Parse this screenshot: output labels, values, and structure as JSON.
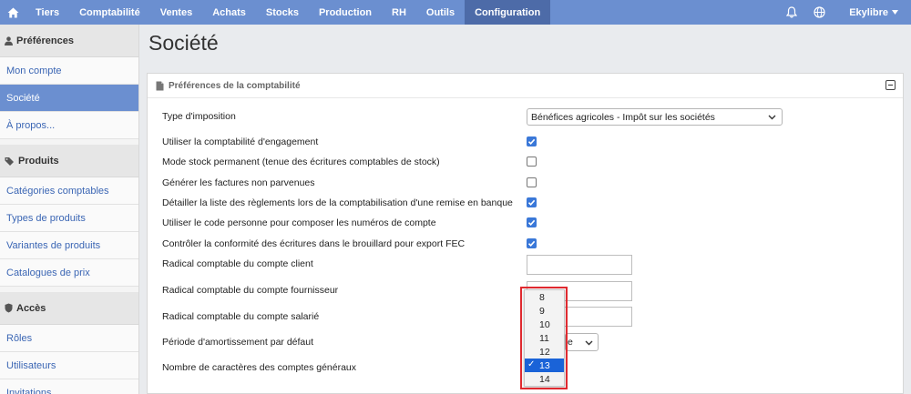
{
  "nav": {
    "items": [
      "Tiers",
      "Comptabilité",
      "Ventes",
      "Achats",
      "Stocks",
      "Production",
      "RH",
      "Outils",
      "Configuration"
    ],
    "active": "Configuration",
    "user": "Ekylibre"
  },
  "sidebar": {
    "sections": [
      {
        "title": "Préférences",
        "items": [
          "Mon compte",
          "Société",
          "À propos..."
        ]
      },
      {
        "title": "Produits",
        "items": [
          "Catégories comptables",
          "Types de produits",
          "Variantes de produits",
          "Catalogues de prix"
        ]
      },
      {
        "title": "Accès",
        "items": [
          "Rôles",
          "Utilisateurs",
          "Invitations"
        ]
      }
    ],
    "active_item": "Société"
  },
  "page": {
    "title": "Société",
    "panel_title": "Préférences de la comptabilité"
  },
  "form": {
    "tax_regime": {
      "label": "Type d'imposition",
      "value": "Bénéfices agricoles - Impôt sur les sociétés"
    },
    "checkboxes": [
      {
        "label": "Utiliser la comptabilité d'engagement",
        "checked": true
      },
      {
        "label": "Mode stock permanent (tenue des écritures comptables de stock)",
        "checked": false
      },
      {
        "label": "Générer les factures non parvenues",
        "checked": false
      },
      {
        "label": "Détailler la liste des règlements lors de la comptabilisation d'une remise en banque",
        "checked": true
      },
      {
        "label": "Utiliser le code personne pour composer les numéros de compte",
        "checked": true
      },
      {
        "label": "Contrôler la conformité des écritures dans le brouillard pour export FEC",
        "checked": true
      }
    ],
    "fields": [
      {
        "label": "Radical comptable du compte client",
        "value": ""
      },
      {
        "label": "Radical comptable du compte fournisseur",
        "value": ""
      },
      {
        "label": "Radical comptable du compte salarié",
        "value": ""
      }
    ],
    "amortization_label": "Période d'amortissement par défaut",
    "amortization_partial": "e",
    "account_chars_label": "Nombre de caractères des comptes généraux",
    "account_chars_options": [
      "8",
      "9",
      "10",
      "11",
      "12",
      "13",
      "14"
    ],
    "account_chars_selected": "13",
    "check_mark": "✓"
  },
  "colors": {
    "nav": "#6b8fd0",
    "nav_active": "#4d6ba8",
    "accent": "#3a78d8",
    "highlight": "#e0292f"
  }
}
